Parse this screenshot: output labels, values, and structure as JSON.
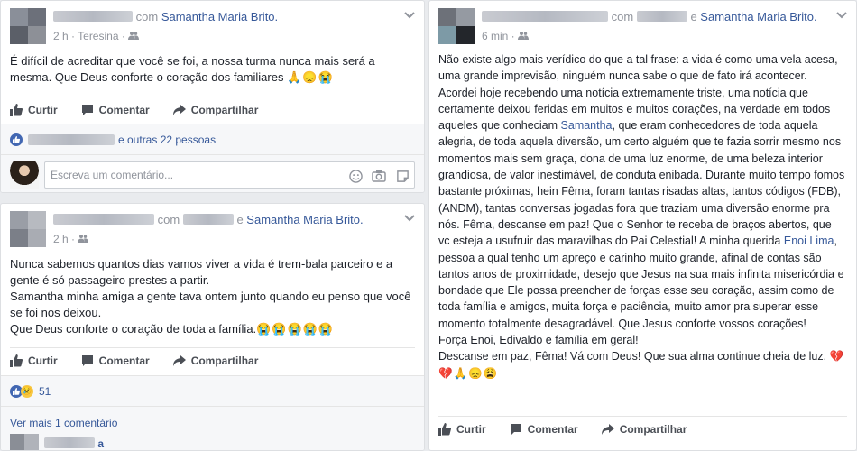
{
  "post1": {
    "with_text": "com",
    "tagged_name": "Samantha Maria Brito.",
    "time": "2 h",
    "location": "Teresina",
    "text": "É difícil de acreditar que você se foi, a nossa turma nunca mais será a mesma. Que Deus conforte o coração dos familiares",
    "emojis": "🙏😞😭",
    "actions": {
      "like": "Curtir",
      "comment": "Comentar",
      "share": "Compartilhar"
    },
    "reactions_text": "e outras 22 pessoas",
    "comment_placeholder": "Escreva um comentário..."
  },
  "post2": {
    "with_text": "com",
    "separator": "e",
    "tagged_name": "Samantha Maria Brito.",
    "time": "2 h",
    "text_lines": [
      "Nunca sabemos quantos dias vamos viver a vida é trem-bala parceiro e a gente é só passageiro prestes a partir.",
      "Samantha minha amiga a gente tava ontem junto quando eu penso que você se foi nos deixou.",
      "Que Deus conforte o coração de toda a família."
    ],
    "emojis": "😭😭😭😭😭",
    "actions": {
      "like": "Curtir",
      "comment": "Comentar",
      "share": "Compartilhar"
    },
    "reaction_count": "51",
    "more_comments": "Ver mais 1 comentário",
    "reply_fragment": "a"
  },
  "post3": {
    "with_text": "com",
    "separator": "e",
    "tagged_name": "Samantha Maria Brito.",
    "time": "6 min",
    "para1_a": "Não existe algo mais verídico do que a tal frase: a vida é como uma vela acesa, uma grande imprevisão, ninguém nunca sabe o que de fato irá acontecer. Acordei hoje recebendo uma notícia extremamente triste, uma notícia que certamente deixou feridas em muitos e muitos corações, na verdade em todos aqueles que conheciam",
    "mention1": "Samantha",
    "para1_b": ", que eram conhecedores de toda aquela alegria, de toda aquela diversão, um certo alguém que te fazia sorrir mesmo nos momentos mais sem graça, dona de uma luz enorme, de uma beleza interior grandiosa, de valor inestimável, de conduta enibada. Durante muito tempo fomos bastante próximas, hein Fêma, foram tantas risadas altas, tantos códigos (FDB), (ANDM), tantas conversas jogadas fora que traziam uma diversão enorme pra nós. Fêma, descanse em paz! Que o Senhor te receba de braços abertos, que vc esteja a usufruir das maravilhas do Pai Celestial! A minha querida",
    "mention2": "Enoi Lima",
    "para1_c": ", pessoa a qual tenho um apreço e carinho muito grande, afinal de contas são tantos anos de proximidade, desejo que Jesus na sua mais infinita misericórdia e bondade que Ele possa preencher de forças esse seu coração, assim como de toda família e amigos, muita força e paciência, muito amor pra superar esse momento totalmente desagradável. Que Jesus conforte vossos corações!",
    "line2": "Força Enoi, Edivaldo e família em geral!",
    "line3": "Descanse em paz, Fêma! Vá com Deus! Que sua alma continue cheia de luz.",
    "emojis": "💔💔🙏😞😩",
    "actions": {
      "like": "Curtir",
      "comment": "Comentar",
      "share": "Compartilhar"
    }
  }
}
